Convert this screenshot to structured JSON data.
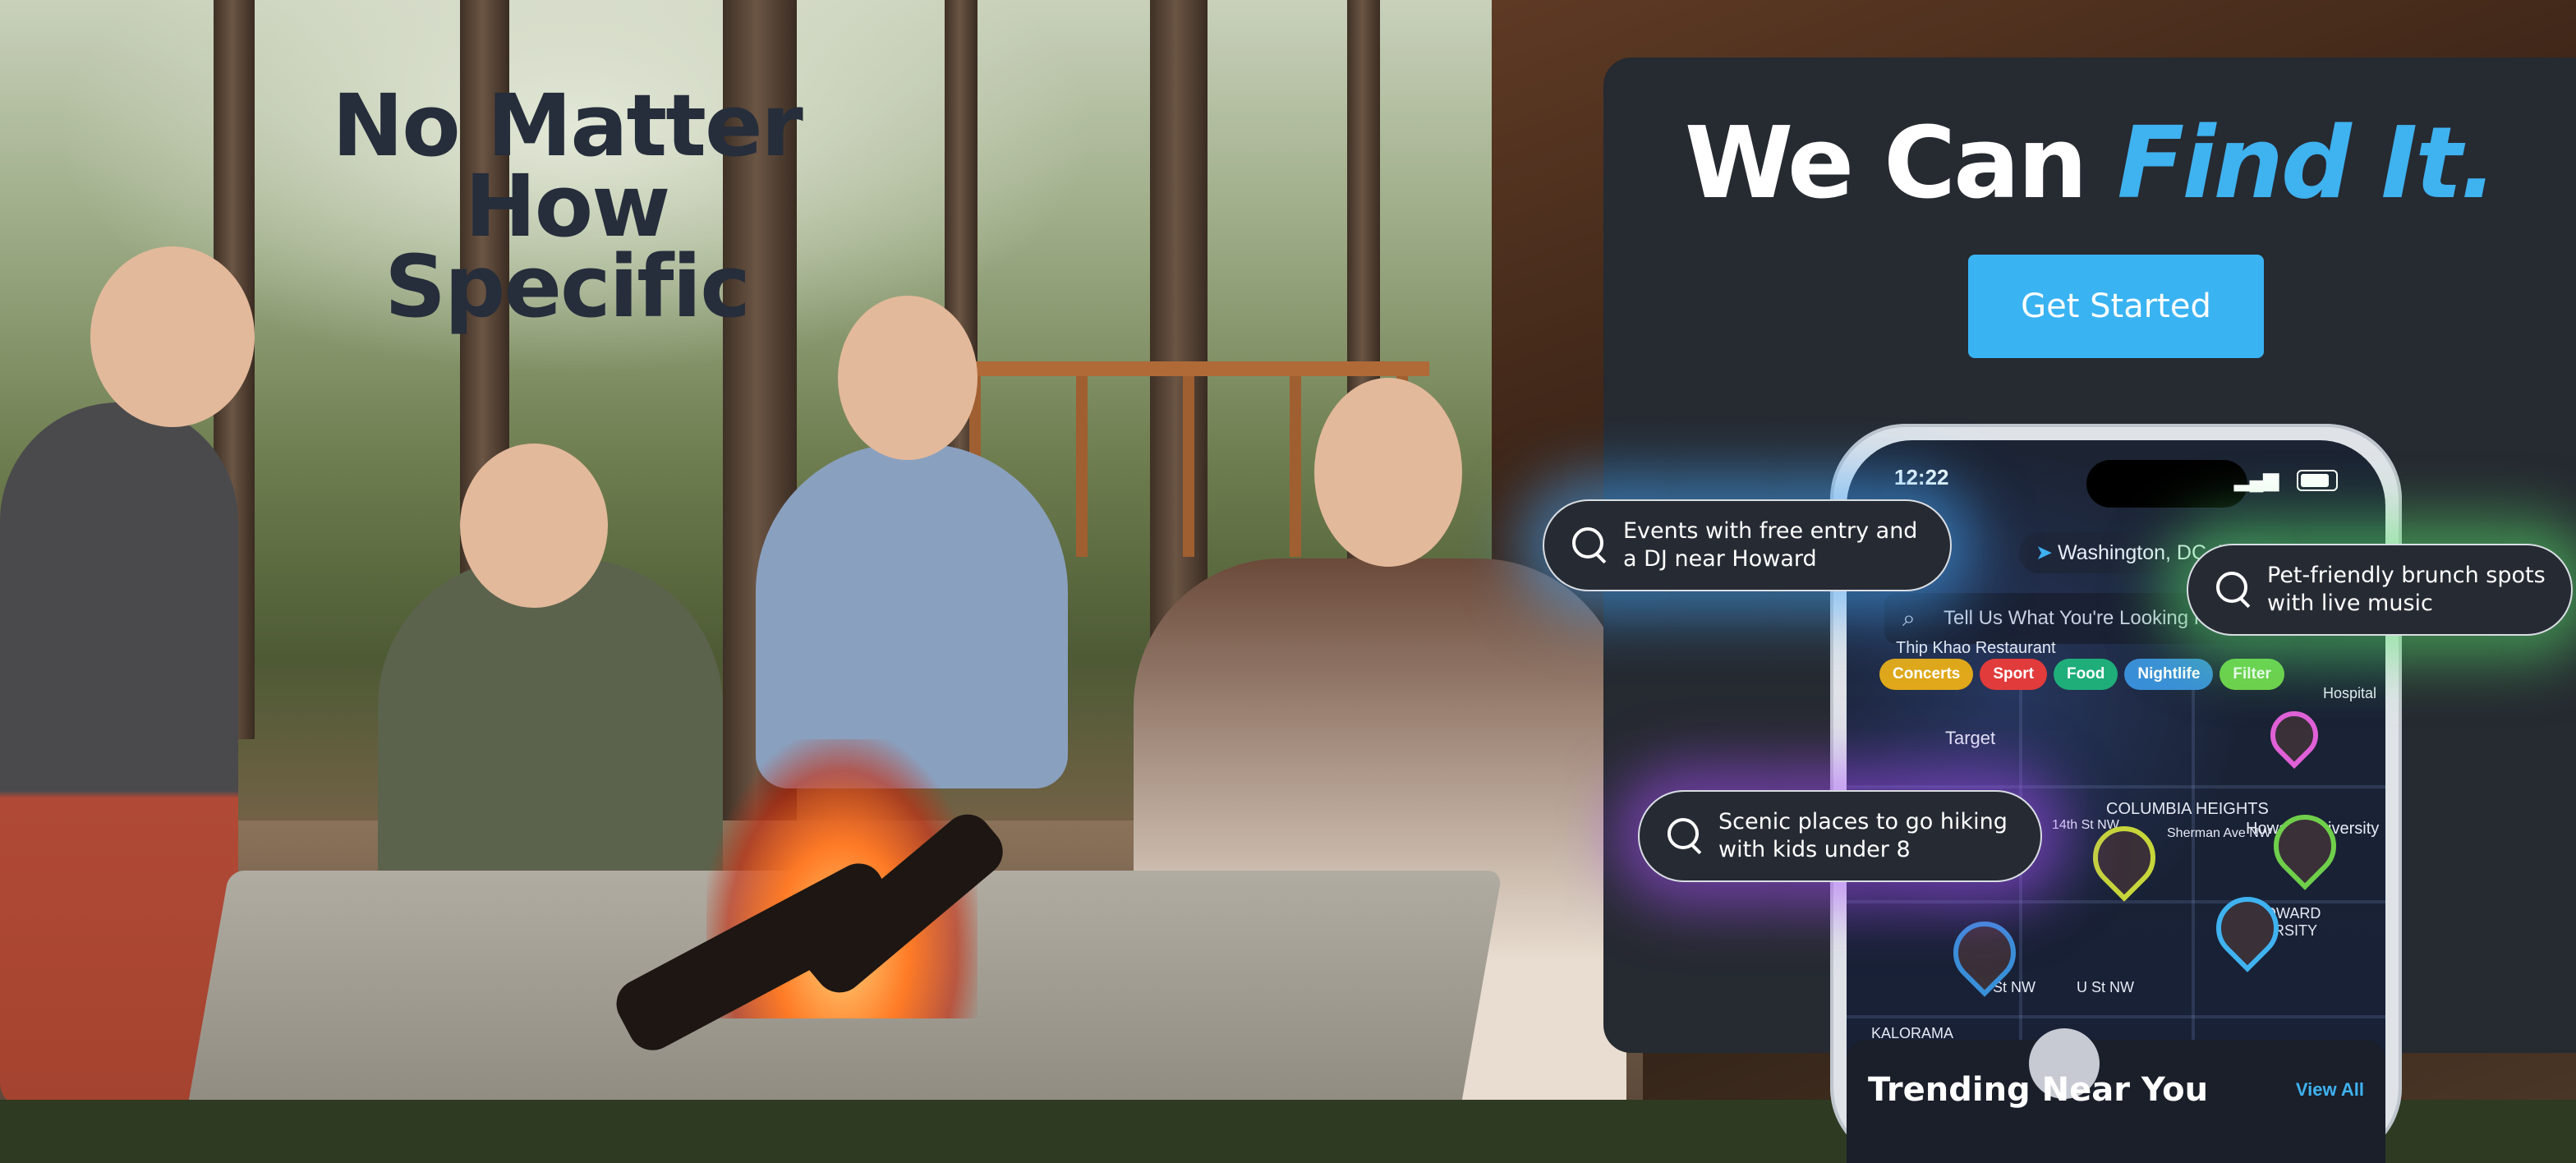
{
  "hero": {
    "headline_line1": "No Matter",
    "headline_line2": "How Specific",
    "title_plain": "We Can ",
    "title_accent": "Find It.",
    "cta_label": "Get Started"
  },
  "phone": {
    "time": "12:22",
    "location": "Washington, DC, USA",
    "search_placeholder": "Tell Us What You're Looking F",
    "map_labels": [
      "Thip Khao Restaurant",
      "Target",
      "COLUMBIA HEIGHTS",
      "Howard University",
      "HOWARD VERSITY",
      "KALORAMA",
      "U St NW",
      "U St NW",
      "14th St NW",
      "Sherman Ave NW",
      "Hospital"
    ],
    "chips": [
      {
        "label": "Concerts",
        "color": "#e0a81a"
      },
      {
        "label": "Sport",
        "color": "#e13b3b"
      },
      {
        "label": "Food",
        "color": "#1fae7a"
      },
      {
        "label": "Nightlife",
        "color": "#3a8fd8"
      },
      {
        "label": "Filter",
        "color": "#6fcf4a"
      }
    ],
    "trending_title": "Trending Near You",
    "view_all": "View All"
  },
  "suggestions": [
    {
      "text": "Events with free entry and a DJ near Howard"
    },
    {
      "text": "Pet-friendly brunch spots with live music"
    },
    {
      "text": "Scenic places to go hiking with kids under 8"
    }
  ],
  "colors": {
    "accent": "#3fb2f0",
    "panel": "#262a31",
    "headline": "#262d3b"
  }
}
